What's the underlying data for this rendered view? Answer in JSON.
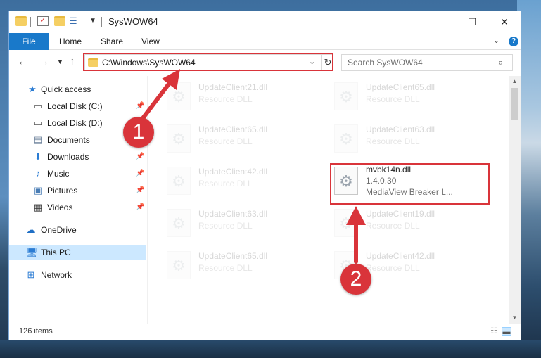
{
  "titlebar": {
    "title": "SysWOW64",
    "minimize": "—",
    "maximize": "☐",
    "close": "✕"
  },
  "ribbon": {
    "tabs": [
      "File",
      "Home",
      "Share",
      "View"
    ]
  },
  "nav": {
    "address": "C:\\Windows\\SysWOW64",
    "search_placeholder": "Search SysWOW64"
  },
  "sidebar": {
    "items": [
      {
        "label": "Quick access",
        "icon": "star-icon",
        "pinned": false,
        "selected": false
      },
      {
        "label": "Local Disk (C:)",
        "icon": "drive-icon",
        "pinned": true,
        "selected": false
      },
      {
        "label": "Local Disk (D:)",
        "icon": "drive-icon",
        "pinned": false,
        "selected": false
      },
      {
        "label": "Documents",
        "icon": "documents-icon",
        "pinned": false,
        "selected": false
      },
      {
        "label": "Downloads",
        "icon": "download-icon",
        "pinned": true,
        "selected": false
      },
      {
        "label": "Music",
        "icon": "music-icon",
        "pinned": true,
        "selected": false
      },
      {
        "label": "Pictures",
        "icon": "pictures-icon",
        "pinned": true,
        "selected": false
      },
      {
        "label": "Videos",
        "icon": "videos-icon",
        "pinned": true,
        "selected": false
      },
      {
        "label": "OneDrive",
        "icon": "cloud-icon",
        "pinned": false,
        "selected": false
      },
      {
        "label": "This PC",
        "icon": "computer-icon",
        "pinned": false,
        "selected": true
      },
      {
        "label": "Network",
        "icon": "network-icon",
        "pinned": false,
        "selected": false
      }
    ]
  },
  "files": [
    {
      "name": "UpdateClient21.dll",
      "desc": "Resource DLL"
    },
    {
      "name": "UpdateClient65.dll",
      "desc": "Resource DLL"
    },
    {
      "name": "UpdateClient65.dll",
      "desc": "Resource DLL"
    },
    {
      "name": "UpdateClient63.dll",
      "desc": "Resource DLL"
    },
    {
      "name": "UpdateClient42.dll",
      "desc": "Resource DLL"
    },
    {
      "name": "mvbk14n.dll",
      "version": "1.4.0.30",
      "desc": "MediaView Breaker L..."
    },
    {
      "name": "UpdateClient63.dll",
      "desc": "Resource DLL"
    },
    {
      "name": "UpdateClient19.dll",
      "desc": "Resource DLL"
    },
    {
      "name": "UpdateClient65.dll",
      "desc": "Resource DLL"
    },
    {
      "name": "UpdateClient42.dll",
      "desc": "Resource DLL"
    }
  ],
  "status": {
    "item_count": "126 items"
  },
  "annotations": {
    "step1": "1",
    "step2": "2"
  },
  "colors": {
    "accent": "#1979ca",
    "highlight": "#d9343a",
    "selected_bg": "#cce8ff"
  }
}
